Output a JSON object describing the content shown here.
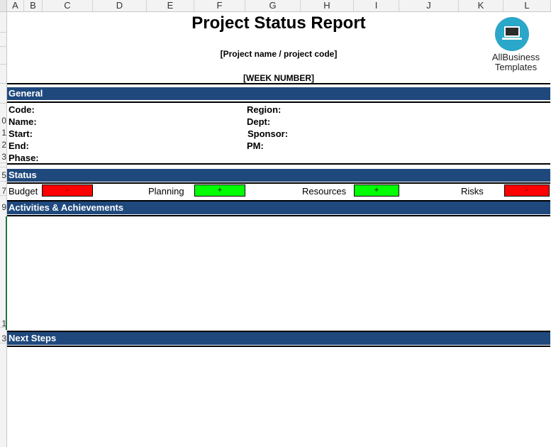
{
  "columns": [
    "A",
    "B",
    "C",
    "D",
    "E",
    "F",
    "G",
    "H",
    "I",
    "J",
    "K",
    "L"
  ],
  "row_numbers": [
    "0",
    "1",
    "2",
    "3",
    "5",
    "7",
    "9",
    "1",
    "3"
  ],
  "report": {
    "title": "Project Status Report",
    "project_name": "[Project name / project code]",
    "week_number": "[WEEK NUMBER]"
  },
  "logo": {
    "line1": "AllBusiness",
    "line2": "Templates"
  },
  "sections": {
    "general": "General",
    "status": "Status",
    "activities": "Activities & Achievements",
    "next_steps": "Next Steps"
  },
  "general_fields": {
    "code": "Code:",
    "name": "Name:",
    "start": "Start:",
    "end": "End:",
    "phase": "Phase:",
    "region": "Region:",
    "dept": "Dept:",
    "sponsor": "Sponsor:",
    "pm": "PM:"
  },
  "status_items": {
    "budget": {
      "label": "Budget",
      "value": "-",
      "color": "#ff0000"
    },
    "planning": {
      "label": "Planning",
      "value": "+",
      "color": "#00ff00"
    },
    "resources": {
      "label": "Resources",
      "value": "+",
      "color": "#00ff00"
    },
    "risks": {
      "label": "Risks",
      "value": "-",
      "color": "#ff0000"
    }
  }
}
